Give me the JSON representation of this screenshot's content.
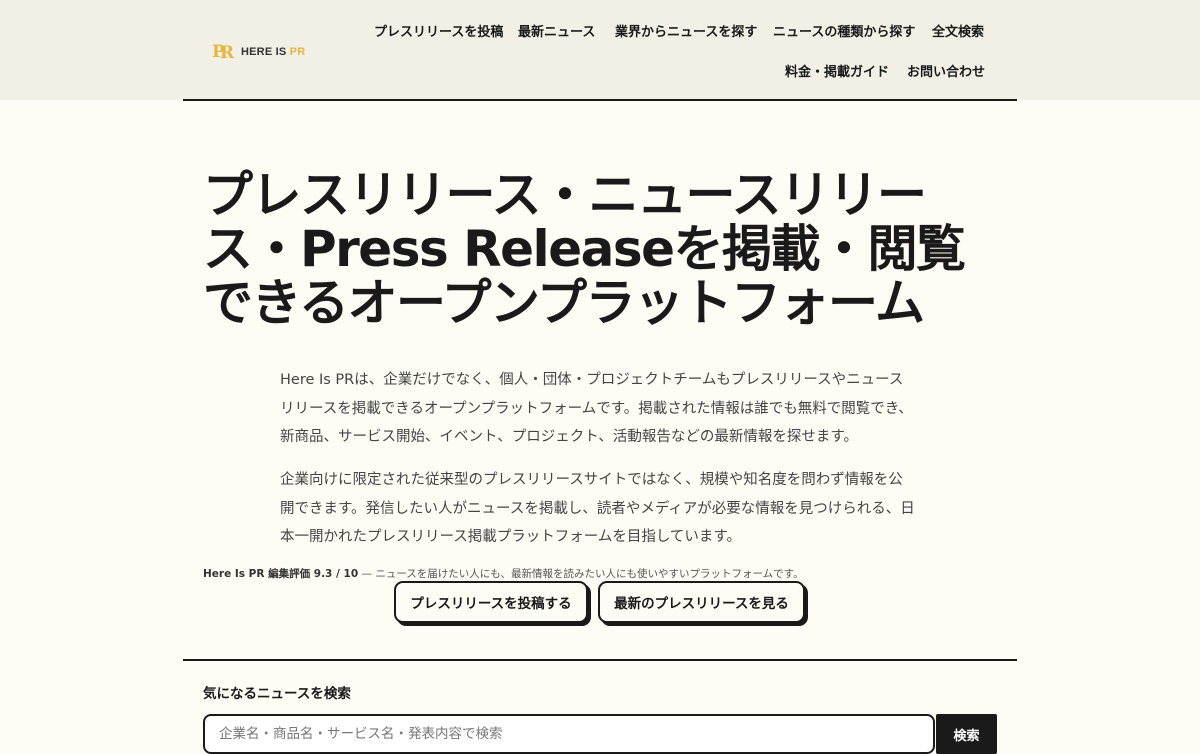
{
  "brand": {
    "logo_mark": "PR",
    "name_part1": "HERE IS ",
    "name_part2": "PR",
    "accent_color": "#e8b640"
  },
  "nav": {
    "items": [
      {
        "label": "プレスリリースを投稿"
      },
      {
        "label": "最新ニュース"
      },
      {
        "label": "業界からニュースを探す"
      },
      {
        "label": "ニュースの種類から探す"
      },
      {
        "label": "全文検索"
      },
      {
        "label": "料金・掲載ガイド"
      },
      {
        "label": "お問い合わせ"
      }
    ]
  },
  "hero": {
    "title": "プレスリリース・ニュースリリース・Press Releaseを掲載・閲覧できるオープンプラットフォーム",
    "paragraphs": [
      "Here Is PRは、企業だけでなく、個人・団体・プロジェクトチームもプレスリリースやニュースリリースを掲載できるオープンプラットフォームです。掲載された情報は誰でも無料で閲覧でき、新商品、サービス開始、イベント、プロジェクト、活動報告などの最新情報を探せます。",
      "企業向けに限定された従来型のプレスリリースサイトではなく、規模や知名度を問わず情報を公開できます。発信したい人がニュースを掲載し、読者やメディアが必要な情報を見つけられる、日本一開かれたプレスリリース掲載プラットフォームを目指しています。"
    ],
    "rating_label": "Here Is PR 編集評価 9.3 / 10",
    "rating_text": " — ニュースを届けたい人にも、最新情報を読みたい人にも使いやすいプラットフォームです。",
    "buttons": {
      "submit": "プレスリリースを投稿する",
      "latest": "最新のプレスリリースを見る"
    }
  },
  "search": {
    "heading": "気になるニュースを検索",
    "placeholder": "企業名・商品名・サービス名・発表内容で検索",
    "value": "",
    "button": "検索"
  }
}
